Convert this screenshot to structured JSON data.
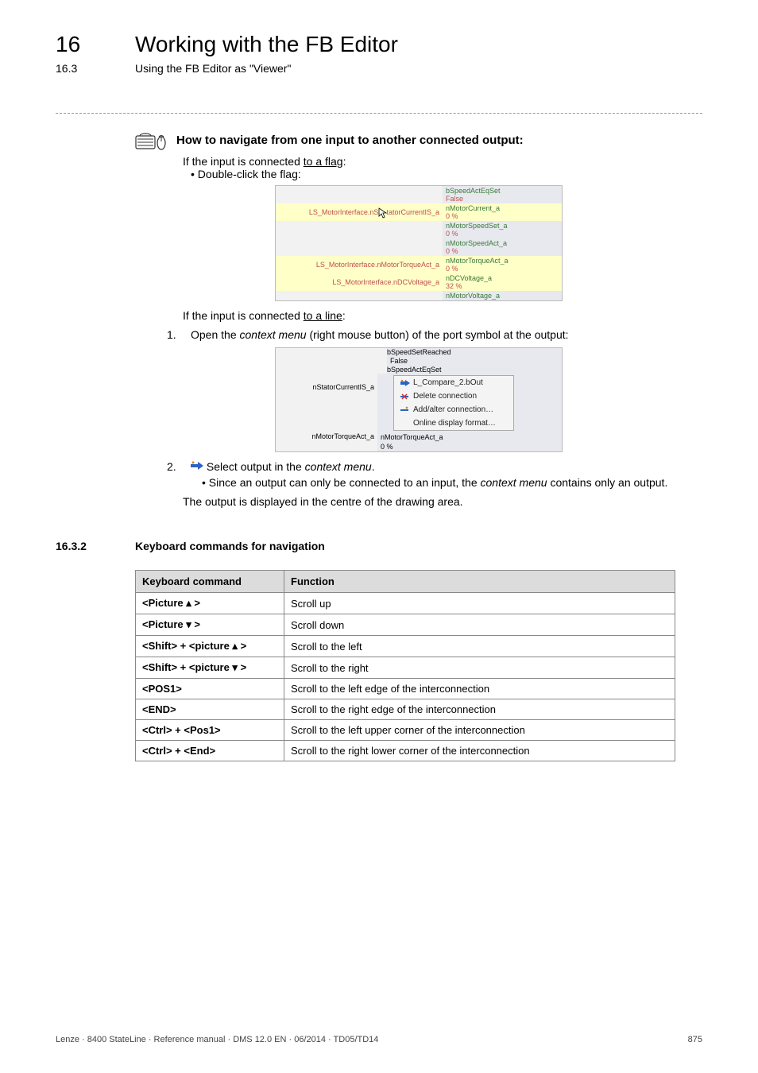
{
  "header": {
    "chapter_number": "16",
    "chapter_title": "Working with the FB Editor",
    "sub_number": "16.3",
    "sub_title": "Using the FB Editor as \"Viewer\""
  },
  "howto": {
    "lead": "How to navigate from one input to another connected output:",
    "case1_intro": "If the input is connected ",
    "case1_underline": "to a flag",
    "case1_tail": ":",
    "case1_bullet": "Double-click the flag:",
    "case2_intro": "If the input is connected ",
    "case2_underline": "to a line",
    "case2_tail": ":"
  },
  "fig1": {
    "rows": [
      {
        "left": "",
        "rlabel": "bSpeedActEqSet",
        "rval": "False",
        "hl": false
      },
      {
        "left": "LS_MotorInterface.nStatorCurrentIS_a",
        "rlabel": "nMotorCurrent_a",
        "rval": "0 %",
        "hl": true,
        "cursor": true
      },
      {
        "left": "",
        "rlabel": "nMotorSpeedSet_a",
        "rval": "0 %",
        "hl": false
      },
      {
        "left": "",
        "rlabel": "nMotorSpeedAct_a",
        "rval": "0 %",
        "hl": false
      },
      {
        "left": "LS_MotorInterface.nMotorTorqueAct_a",
        "rlabel": "nMotorTorqueAct_a",
        "rval": "0 %",
        "hl": true
      },
      {
        "left": "LS_MotorInterface.nDCVoltage_a",
        "rlabel": "nDCVoltage_a",
        "rval": "32 %",
        "hl": true
      },
      {
        "left": "",
        "rlabel": "nMotorVoltage_a",
        "rval": "",
        "hl": false
      }
    ]
  },
  "step1_pre": "Open the ",
  "step1_em": "context menu",
  "step1_post": " (right mouse button) of the port symbol at the output:",
  "fig2": {
    "top_labels": [
      "bSpeedSetReached",
      "False",
      "bSpeedActEqSet"
    ],
    "left_labels": [
      "nStatorCurrentIS_a",
      "nMotorTorqueAct_a"
    ],
    "menu": {
      "item1": "L_Compare_2.bOut",
      "item2": "Delete connection",
      "item3": "Add/alter connection…",
      "item4": "Online display format…"
    },
    "bottom": {
      "label": "nMotorTorqueAct_a",
      "val": "0 %"
    }
  },
  "step2_pre": "Select  output in the ",
  "step2_em": "context menu",
  "step2_post": ".",
  "step2_bullet_pre": "Since an output can only be connected to an input, the ",
  "step2_bullet_em": "context menu",
  "step2_bullet_post": " contains only an output.",
  "result": "The output is displayed in the centre of the drawing area.",
  "section": {
    "num": "16.3.2",
    "title": "Keyboard commands for navigation"
  },
  "table": {
    "head": {
      "cmd": "Keyboard command",
      "fn": "Function"
    },
    "rows": [
      {
        "cmd": "<Picture ▴ >",
        "fn": "Scroll up"
      },
      {
        "cmd": "<Picture ▾ >",
        "fn": "Scroll down"
      },
      {
        "cmd": "<Shift> + <picture ▴ >",
        "fn": "Scroll to the left"
      },
      {
        "cmd": "<Shift> + <picture ▾ >",
        "fn": "Scroll to the right"
      },
      {
        "cmd": "<POS1>",
        "fn": "Scroll to the left edge of the interconnection"
      },
      {
        "cmd": "<END>",
        "fn": "Scroll to the right edge of the interconnection"
      },
      {
        "cmd": "<Ctrl> + <Pos1>",
        "fn": "Scroll to the left upper corner of the interconnection"
      },
      {
        "cmd": "<Ctrl> + <End>",
        "fn": "Scroll to the right lower corner of the interconnection"
      }
    ]
  },
  "footer": {
    "left": "Lenze · 8400 StateLine · Reference manual · DMS 12.0 EN · 06/2014 · TD05/TD14",
    "right": "875"
  }
}
